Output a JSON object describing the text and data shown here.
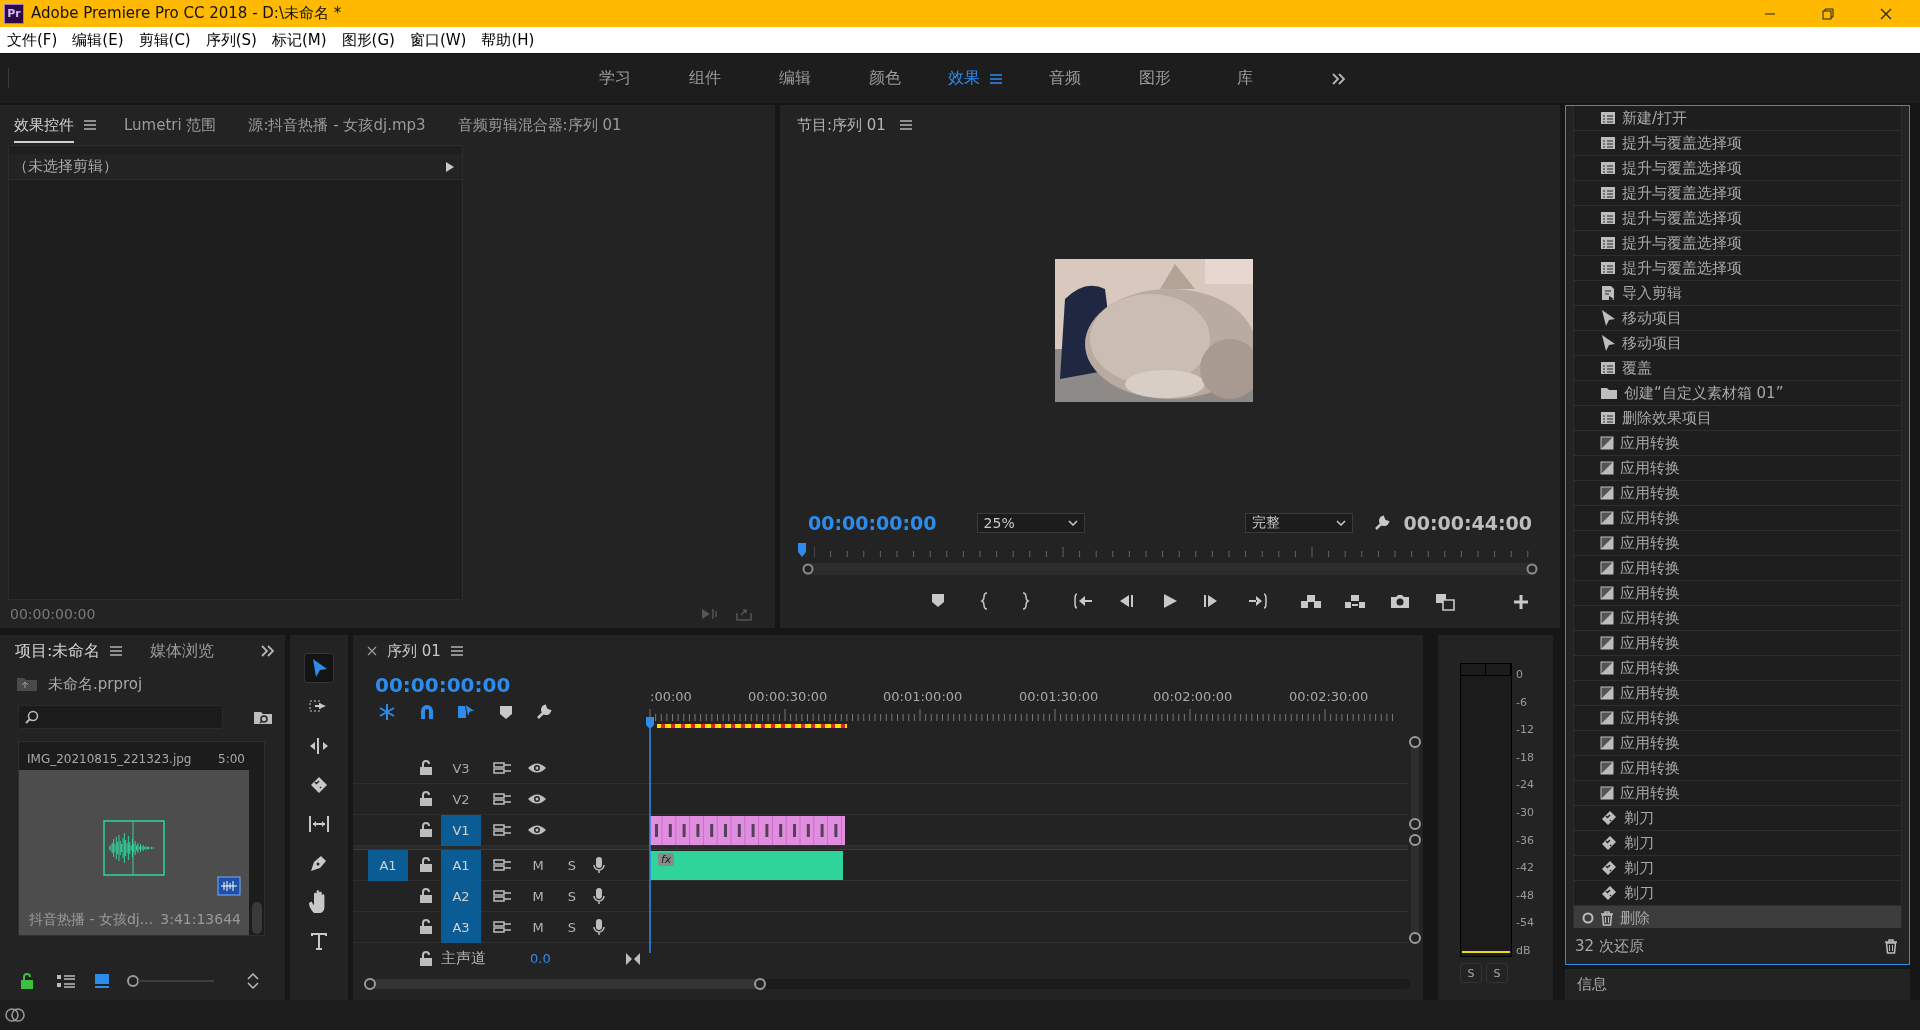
{
  "window": {
    "logo": "Pr",
    "title": "Adobe Premiere Pro CC 2018 - D:\\未命名 *"
  },
  "menu": [
    "文件(F)",
    "编辑(E)",
    "剪辑(C)",
    "序列(S)",
    "标记(M)",
    "图形(G)",
    "窗口(W)",
    "帮助(H)"
  ],
  "workspaces": [
    {
      "label": "学习",
      "selected": false
    },
    {
      "label": "组件",
      "selected": false
    },
    {
      "label": "编辑",
      "selected": false
    },
    {
      "label": "颜色",
      "selected": false
    },
    {
      "label": "效果",
      "selected": true
    },
    {
      "label": "音频",
      "selected": false
    },
    {
      "label": "图形",
      "selected": false
    },
    {
      "label": "库",
      "selected": false
    }
  ],
  "effect_controls": {
    "tabs": [
      {
        "label": "效果控件",
        "selected": true
      },
      {
        "label": "Lumetri 范围",
        "selected": false
      },
      {
        "label": "源:抖音热播 - 女孩dj.mp3",
        "selected": false
      },
      {
        "label": "音频剪辑混合器:序列 01",
        "selected": false
      }
    ],
    "clip_header": "（未选择剪辑）",
    "timecode": "00:00:00:00"
  },
  "program_monitor": {
    "title": "节目:序列 01",
    "timecode": "00:00:00:00",
    "zoom": "25%",
    "quality": "完整",
    "duration": "00:00:44:00"
  },
  "history": {
    "items": [
      {
        "kind": "list",
        "label": "新建/打开",
        "selected": false
      },
      {
        "kind": "list",
        "label": "提升与覆盖选择项",
        "selected": false
      },
      {
        "kind": "list",
        "label": "提升与覆盖选择项",
        "selected": false
      },
      {
        "kind": "list",
        "label": "提升与覆盖选择项",
        "selected": false
      },
      {
        "kind": "list",
        "label": "提升与覆盖选择项",
        "selected": false
      },
      {
        "kind": "list",
        "label": "提升与覆盖选择项",
        "selected": false
      },
      {
        "kind": "list",
        "label": "提升与覆盖选择项",
        "selected": false
      },
      {
        "kind": "import",
        "label": "导入剪辑",
        "selected": false
      },
      {
        "kind": "arrow",
        "label": "移动项目",
        "selected": false
      },
      {
        "kind": "arrow",
        "label": "移动项目",
        "selected": false
      },
      {
        "kind": "list",
        "label": "覆盖",
        "selected": false
      },
      {
        "kind": "folder",
        "label": "创建“自定义素材箱 01”",
        "selected": false
      },
      {
        "kind": "list",
        "label": "删除效果项目",
        "selected": false
      },
      {
        "kind": "transition",
        "label": "应用转换",
        "selected": false
      },
      {
        "kind": "transition",
        "label": "应用转换",
        "selected": false
      },
      {
        "kind": "transition",
        "label": "应用转换",
        "selected": false
      },
      {
        "kind": "transition",
        "label": "应用转换",
        "selected": false
      },
      {
        "kind": "transition",
        "label": "应用转换",
        "selected": false
      },
      {
        "kind": "transition",
        "label": "应用转换",
        "selected": false
      },
      {
        "kind": "transition",
        "label": "应用转换",
        "selected": false
      },
      {
        "kind": "transition",
        "label": "应用转换",
        "selected": false
      },
      {
        "kind": "transition",
        "label": "应用转换",
        "selected": false
      },
      {
        "kind": "transition",
        "label": "应用转换",
        "selected": false
      },
      {
        "kind": "transition",
        "label": "应用转换",
        "selected": false
      },
      {
        "kind": "transition",
        "label": "应用转换",
        "selected": false
      },
      {
        "kind": "transition",
        "label": "应用转换",
        "selected": false
      },
      {
        "kind": "transition",
        "label": "应用转换",
        "selected": false
      },
      {
        "kind": "transition",
        "label": "应用转换",
        "selected": false
      },
      {
        "kind": "razor",
        "label": "剃刀",
        "selected": false
      },
      {
        "kind": "razor",
        "label": "剃刀",
        "selected": false
      },
      {
        "kind": "razor",
        "label": "剃刀",
        "selected": false
      },
      {
        "kind": "razor",
        "label": "剃刀",
        "selected": false
      },
      {
        "kind": "trash",
        "label": "删除",
        "selected": true
      }
    ],
    "footer": "32 次还原"
  },
  "info_panel": {
    "title": "信息"
  },
  "project": {
    "tabs": [
      {
        "label": "项目:未命名",
        "selected": true
      },
      {
        "label": "媒体浏览",
        "selected": false
      }
    ],
    "file": "未命名.prproj",
    "items": [
      {
        "name": "IMG_20210815_221323.jpg",
        "duration": "5:00"
      },
      {
        "kind": "audio",
        "name": "抖音热播 - 女孩dj...",
        "duration": "3:41:13644"
      }
    ]
  },
  "tools": [
    {
      "kind": "selection",
      "selected": true
    },
    {
      "kind": "track-select",
      "selected": false
    },
    {
      "kind": "ripple",
      "selected": false
    },
    {
      "kind": "razor",
      "selected": false
    },
    {
      "kind": "slip",
      "selected": false
    },
    {
      "kind": "pen",
      "selected": false
    },
    {
      "kind": "hand",
      "selected": false
    },
    {
      "kind": "type",
      "selected": false
    }
  ],
  "timeline": {
    "tab": "序列 01",
    "timecode": "00:00:00:00",
    "ruler": [
      ":00:00",
      "00:00:30:00",
      "00:01:00:00",
      "00:01:30:00",
      "00:02:00:00",
      "00:02:30:00"
    ],
    "tracks": [
      {
        "kind": "video",
        "label": "V3",
        "targeted": false,
        "has_clip": false
      },
      {
        "kind": "video",
        "label": "V2",
        "targeted": false,
        "has_clip": false
      },
      {
        "kind": "video",
        "label": "V1",
        "targeted": true,
        "has_clip": true
      },
      {
        "kind": "audio",
        "label": "A1",
        "targeted": true,
        "has_clip": true,
        "source": "A1",
        "mute": "M",
        "solo": "S",
        "clip_badge": "fx"
      },
      {
        "kind": "audio",
        "label": "A2",
        "targeted": true,
        "has_clip": false,
        "mute": "M",
        "solo": "S"
      },
      {
        "kind": "audio",
        "label": "A3",
        "targeted": true,
        "has_clip": false,
        "mute": "M",
        "solo": "S"
      }
    ],
    "master": {
      "label": "主声道",
      "value": "0.0"
    }
  },
  "meter": {
    "scale": [
      "0",
      "-6",
      "-12",
      "-18",
      "-24",
      "-30",
      "-36",
      "-42",
      "-48",
      "-54",
      "dB"
    ],
    "solo": [
      "S",
      "S"
    ]
  }
}
